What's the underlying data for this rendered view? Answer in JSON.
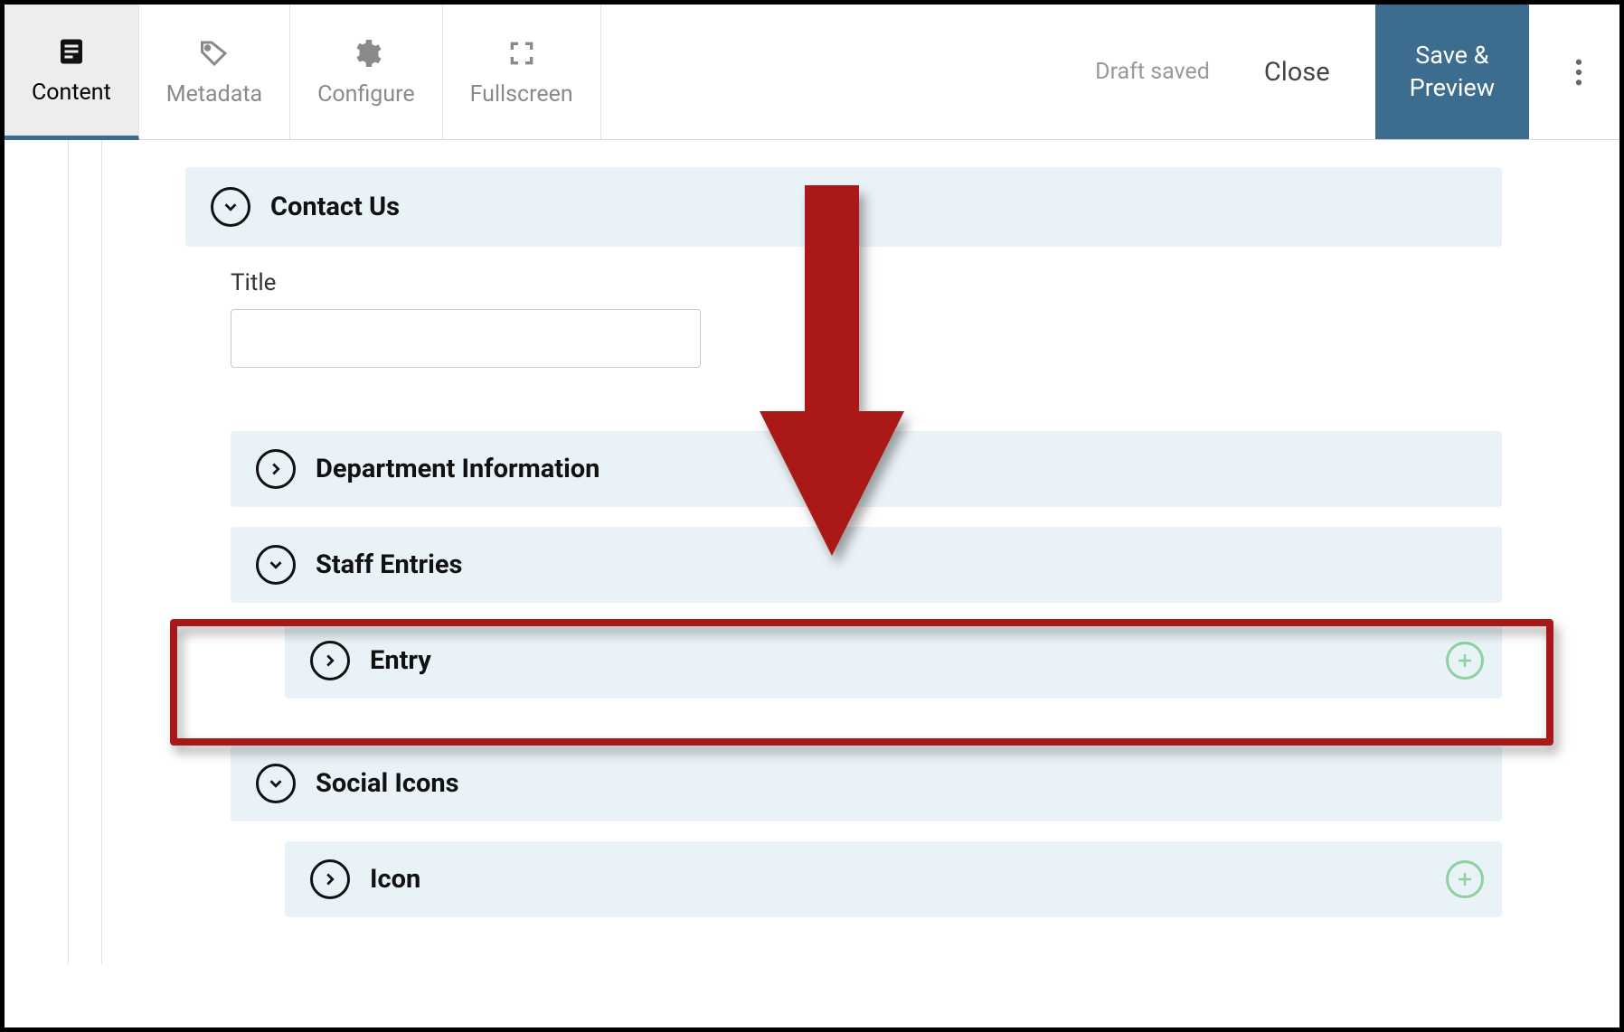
{
  "toolbar": {
    "tabs": [
      {
        "label": "Content",
        "icon": "content"
      },
      {
        "label": "Metadata",
        "icon": "tag"
      },
      {
        "label": "Configure",
        "icon": "gear"
      },
      {
        "label": "Fullscreen",
        "icon": "fullscreen"
      }
    ],
    "draft_status": "Draft saved",
    "close_label": "Close",
    "save_label": "Save &\nPreview"
  },
  "content": {
    "sections": {
      "contact_us": {
        "title": "Contact Us",
        "expanded": true
      },
      "title_field": {
        "label": "Title",
        "value": ""
      },
      "dept_info": {
        "title": "Department Information",
        "expanded": false
      },
      "staff_entries": {
        "title": "Staff Entries",
        "expanded": true
      },
      "entry": {
        "title": "Entry",
        "expanded": false
      },
      "social_icons": {
        "title": "Social Icons",
        "expanded": true
      },
      "icon": {
        "title": "Icon",
        "expanded": false
      }
    }
  }
}
